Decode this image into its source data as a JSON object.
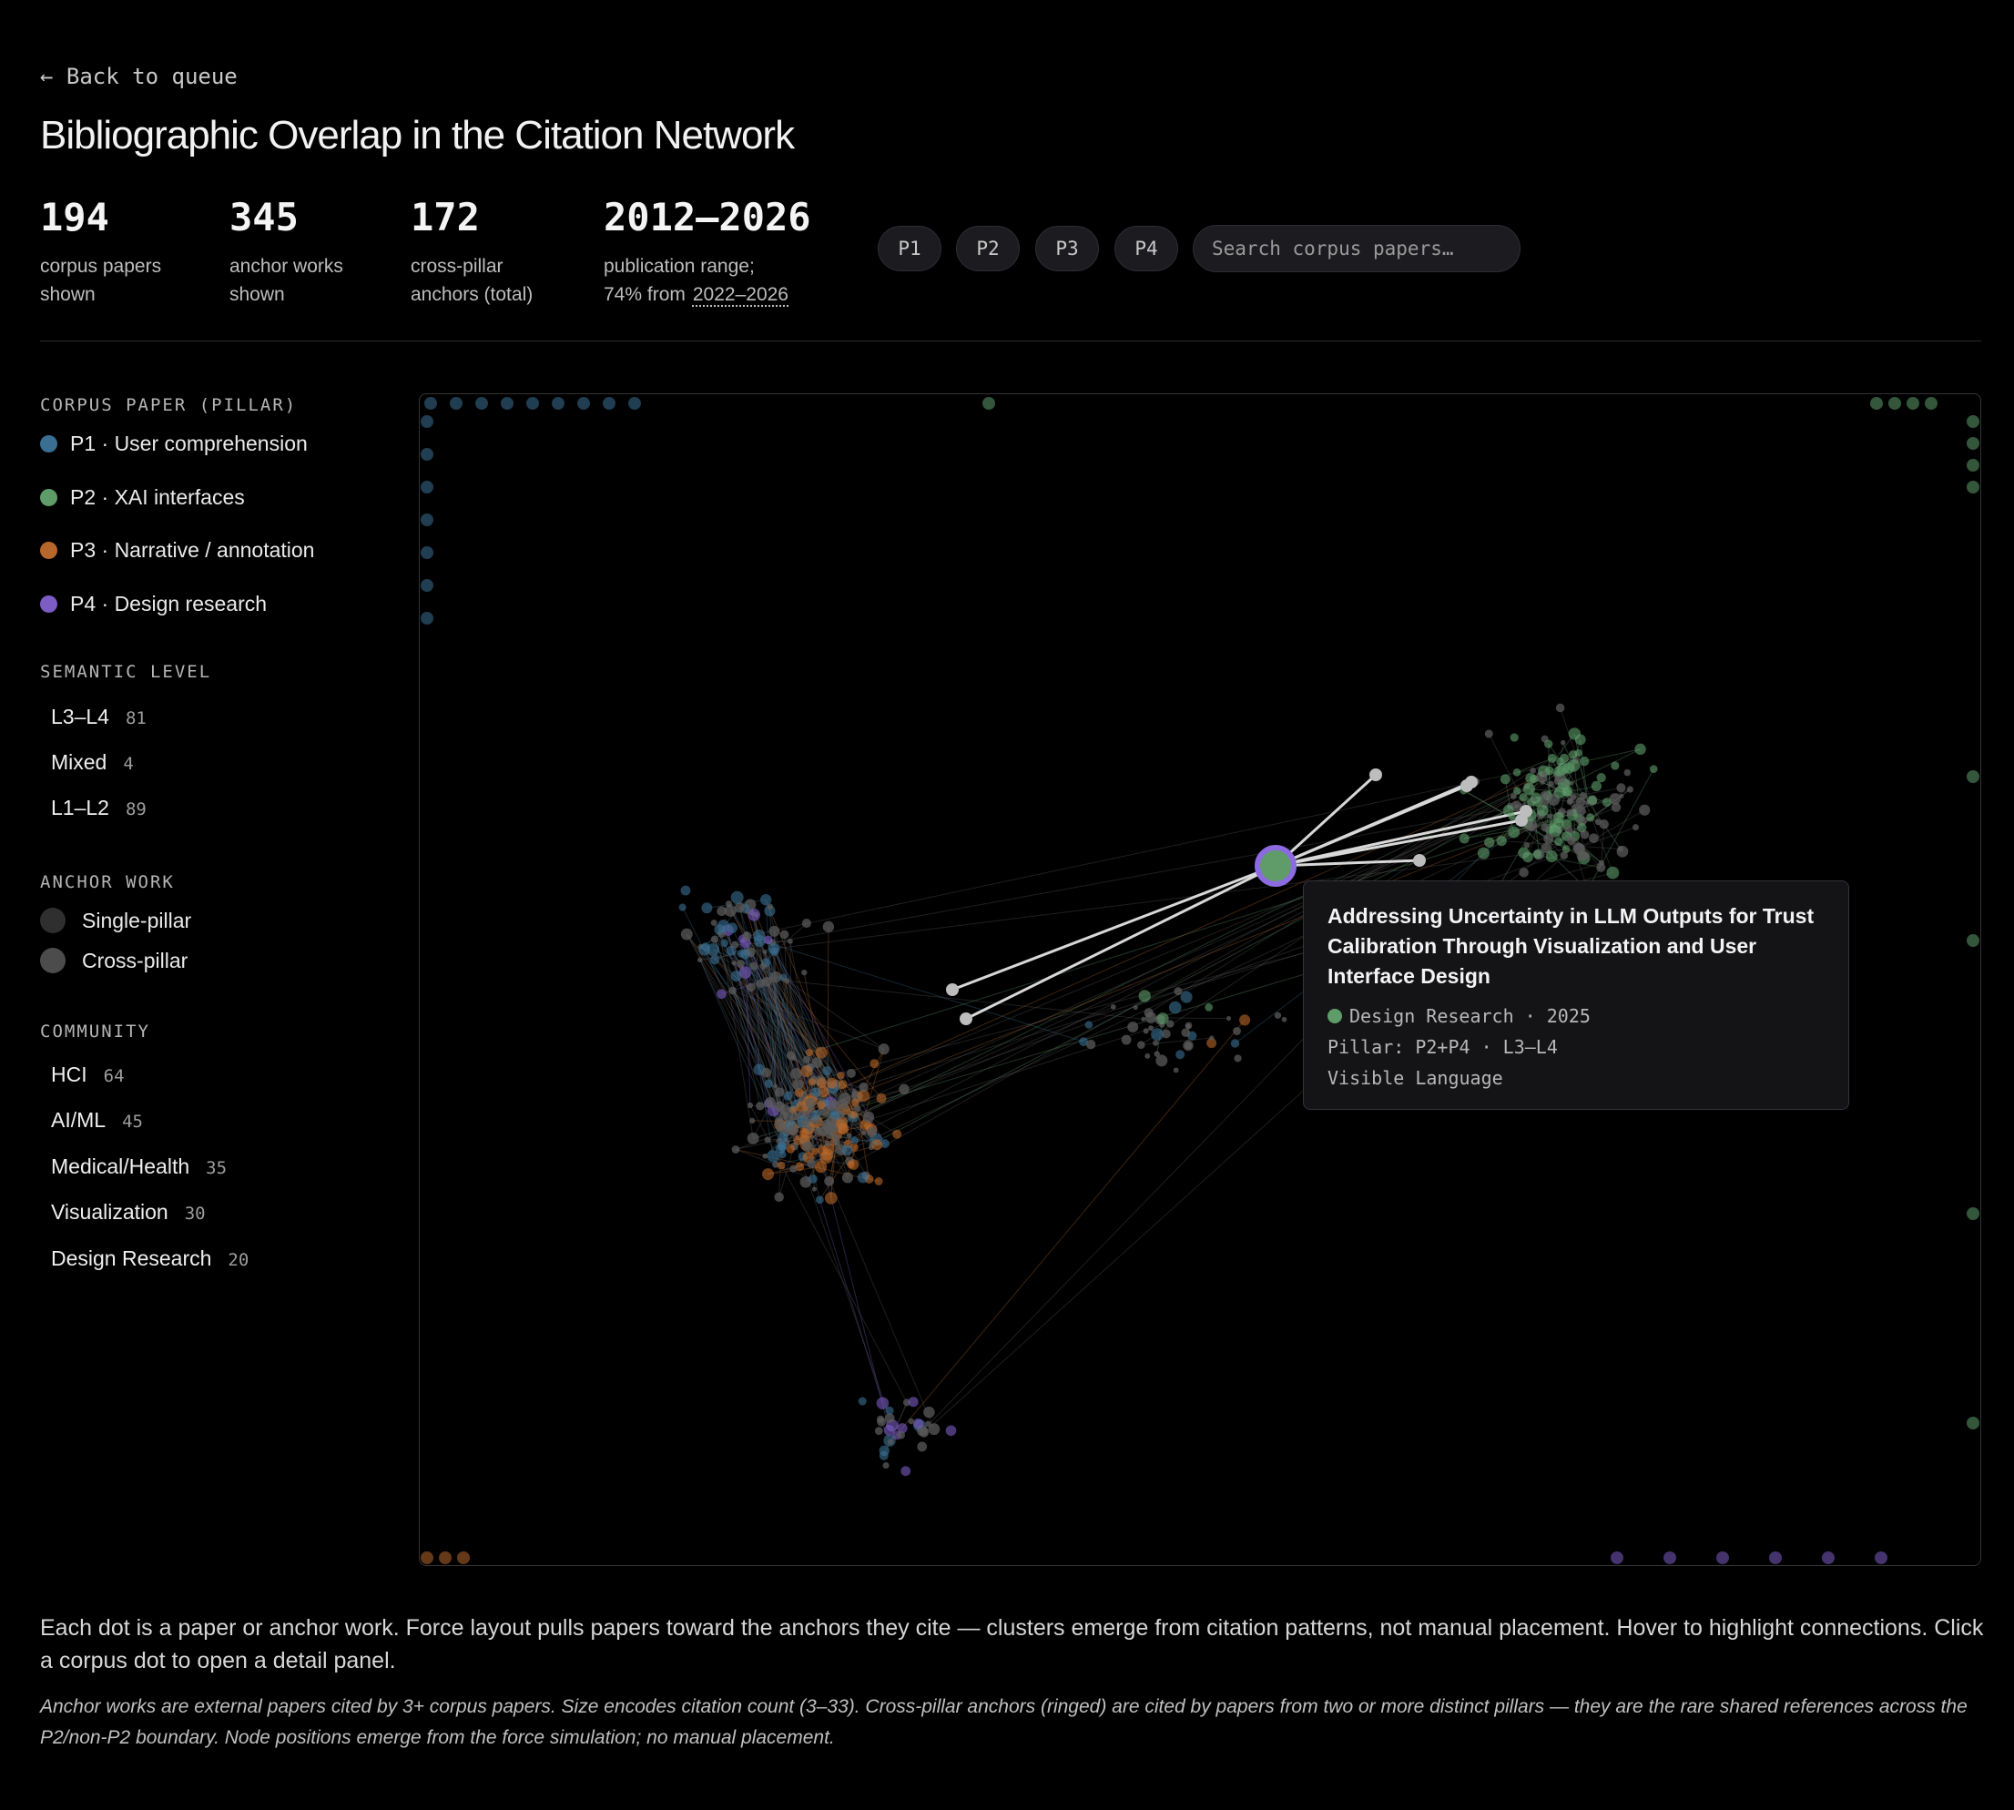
{
  "nav": {
    "back_label": "← Back to queue"
  },
  "page": {
    "title": "Bibliographic Overlap in the Citation Network"
  },
  "stats": [
    {
      "value": "194",
      "label": "corpus papers shown"
    },
    {
      "value": "345",
      "label": "anchor works shown"
    },
    {
      "value": "172",
      "label": "cross-pillar anchors (total)"
    },
    {
      "value": "2012–2026",
      "label": "publication range;",
      "label2": "74% from",
      "range": "2022–2026"
    }
  ],
  "filters": [
    {
      "label": "P1"
    },
    {
      "label": "P2"
    },
    {
      "label": "P3"
    },
    {
      "label": "P4"
    }
  ],
  "search": {
    "placeholder": "Search corpus papers…"
  },
  "legend": {
    "corpus_title": "CORPUS PAPER (PILLAR)",
    "pillars": [
      {
        "label": "P1 · User comprehension",
        "color": "#3a6f93"
      },
      {
        "label": "P2 · XAI interfaces",
        "color": "#5f9c6a"
      },
      {
        "label": "P3 · Narrative / annotation",
        "color": "#b8672a"
      },
      {
        "label": "P4 · Design research",
        "color": "#7c5dc4"
      }
    ],
    "semantic_title": "SEMANTIC LEVEL",
    "semantic": [
      {
        "label": "L3–L4",
        "count": "81"
      },
      {
        "label": "Mixed",
        "count": "4"
      },
      {
        "label": "L1–L2",
        "count": "89"
      }
    ],
    "anchor_title": "ANCHOR WORK",
    "anchors": [
      {
        "label": "Single-pillar",
        "color": "#2f2f2f"
      },
      {
        "label": "Cross-pillar",
        "color": "#4c4c4c"
      }
    ],
    "community_title": "COMMUNITY",
    "communities": [
      {
        "label": "HCI",
        "count": "64"
      },
      {
        "label": "AI/ML",
        "count": "45"
      },
      {
        "label": "Medical/Health",
        "count": "35"
      },
      {
        "label": "Visualization",
        "count": "30"
      },
      {
        "label": "Design Research",
        "count": "20"
      }
    ]
  },
  "tooltip": {
    "title": "Addressing Uncertainty in LLM Outputs for Trust Calibration Through Visualization and User Interface Design",
    "community_year": "Design Research · 2025",
    "pillar_line": "Pillar: P2+P4 · L3–L4",
    "venue": "Visible Language"
  },
  "footer": {
    "description": "Each dot is a paper or anchor work. Force layout pulls papers toward the anchors they cite — clusters emerge from citation patterns, not manual placement. Hover to highlight connections. Click a corpus dot to open a detail panel.",
    "note": "Anchor works are external papers cited by 3+ corpus papers. Size encodes citation count (3–33). Cross-pillar anchors (ringed) are cited by papers from two or more distinct pillars — they are the rare shared references across the P2/non-P2 boundary. Node positions emerge from the force simulation; no manual placement."
  }
}
